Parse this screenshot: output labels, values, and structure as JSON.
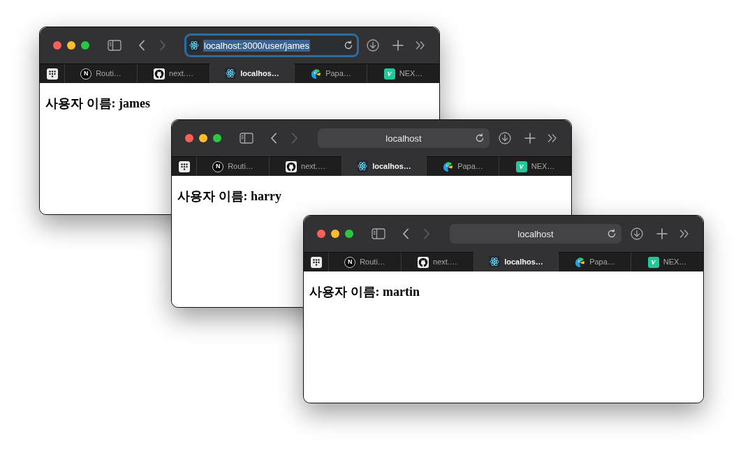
{
  "windows": [
    {
      "toolbar": {
        "nav": [
          {
            "kind": "back",
            "disabled": false
          },
          {
            "kind": "forward",
            "disabled": true
          }
        ],
        "address_bar": {
          "text": "localhost:3000/user/james",
          "focused": true,
          "text_selected": true
        }
      },
      "tabs": [
        {
          "label": "Routi…",
          "selected": false,
          "favicon": {
            "kind": "disc",
            "letter": "N"
          }
        },
        {
          "label": "next.…",
          "selected": false,
          "favicon": {
            "kind": "cat"
          }
        },
        {
          "label": "localhos…",
          "selected": true,
          "favicon": {
            "kind": "atom"
          }
        },
        {
          "label": "Papa…",
          "selected": false,
          "favicon": {
            "kind": "bird"
          }
        },
        {
          "label": "NEX…",
          "selected": false,
          "favicon": {
            "kind": "tile",
            "letter": "v"
          }
        }
      ],
      "page": {
        "heading": "사용자 이름: james"
      }
    },
    {
      "toolbar": {
        "nav": [
          {
            "kind": "back",
            "disabled": false
          },
          {
            "kind": "forward",
            "disabled": true
          }
        ],
        "address_bar": {
          "text": "localhost",
          "focused": false,
          "text_selected": false
        }
      },
      "tabs": [
        {
          "label": "Routi…",
          "selected": false,
          "favicon": {
            "kind": "disc",
            "letter": "N"
          }
        },
        {
          "label": "next.…",
          "selected": false,
          "favicon": {
            "kind": "cat"
          }
        },
        {
          "label": "localhos…",
          "selected": true,
          "favicon": {
            "kind": "atom"
          }
        },
        {
          "label": "Papa…",
          "selected": false,
          "favicon": {
            "kind": "bird"
          }
        },
        {
          "label": "NEX…",
          "selected": false,
          "favicon": {
            "kind": "tile",
            "letter": "v"
          }
        }
      ],
      "page": {
        "heading": "사용자 이름: harry"
      }
    },
    {
      "toolbar": {
        "nav": [
          {
            "kind": "back",
            "disabled": false
          },
          {
            "kind": "forward",
            "disabled": true
          }
        ],
        "address_bar": {
          "text": "localhost",
          "focused": false,
          "text_selected": false
        }
      },
      "tabs": [
        {
          "label": "Routi…",
          "selected": false,
          "favicon": {
            "kind": "disc",
            "letter": "N"
          }
        },
        {
          "label": "next.…",
          "selected": false,
          "favicon": {
            "kind": "cat"
          }
        },
        {
          "label": "localhos…",
          "selected": true,
          "favicon": {
            "kind": "atom"
          }
        },
        {
          "label": "Papa…",
          "selected": false,
          "favicon": {
            "kind": "bird"
          }
        },
        {
          "label": "NEX…",
          "selected": false,
          "favicon": {
            "kind": "tile",
            "letter": "v"
          }
        }
      ],
      "page": {
        "heading": "사용자 이름: martin"
      }
    }
  ]
}
